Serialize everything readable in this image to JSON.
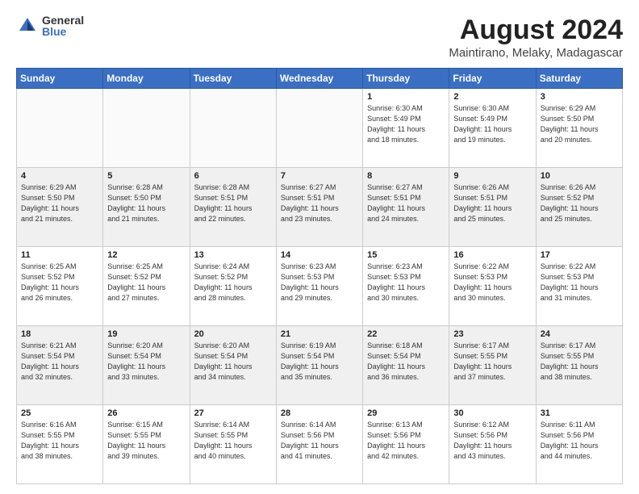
{
  "header": {
    "logo_general": "General",
    "logo_blue": "Blue",
    "title": "August 2024",
    "subtitle": "Maintirano, Melaky, Madagascar"
  },
  "days_of_week": [
    "Sunday",
    "Monday",
    "Tuesday",
    "Wednesday",
    "Thursday",
    "Friday",
    "Saturday"
  ],
  "weeks": [
    [
      {
        "day": "",
        "info": ""
      },
      {
        "day": "",
        "info": ""
      },
      {
        "day": "",
        "info": ""
      },
      {
        "day": "",
        "info": ""
      },
      {
        "day": "1",
        "info": "Sunrise: 6:30 AM\nSunset: 5:49 PM\nDaylight: 11 hours\nand 18 minutes."
      },
      {
        "day": "2",
        "info": "Sunrise: 6:30 AM\nSunset: 5:49 PM\nDaylight: 11 hours\nand 19 minutes."
      },
      {
        "day": "3",
        "info": "Sunrise: 6:29 AM\nSunset: 5:50 PM\nDaylight: 11 hours\nand 20 minutes."
      }
    ],
    [
      {
        "day": "4",
        "info": "Sunrise: 6:29 AM\nSunset: 5:50 PM\nDaylight: 11 hours\nand 21 minutes."
      },
      {
        "day": "5",
        "info": "Sunrise: 6:28 AM\nSunset: 5:50 PM\nDaylight: 11 hours\nand 21 minutes."
      },
      {
        "day": "6",
        "info": "Sunrise: 6:28 AM\nSunset: 5:51 PM\nDaylight: 11 hours\nand 22 minutes."
      },
      {
        "day": "7",
        "info": "Sunrise: 6:27 AM\nSunset: 5:51 PM\nDaylight: 11 hours\nand 23 minutes."
      },
      {
        "day": "8",
        "info": "Sunrise: 6:27 AM\nSunset: 5:51 PM\nDaylight: 11 hours\nand 24 minutes."
      },
      {
        "day": "9",
        "info": "Sunrise: 6:26 AM\nSunset: 5:51 PM\nDaylight: 11 hours\nand 25 minutes."
      },
      {
        "day": "10",
        "info": "Sunrise: 6:26 AM\nSunset: 5:52 PM\nDaylight: 11 hours\nand 25 minutes."
      }
    ],
    [
      {
        "day": "11",
        "info": "Sunrise: 6:25 AM\nSunset: 5:52 PM\nDaylight: 11 hours\nand 26 minutes."
      },
      {
        "day": "12",
        "info": "Sunrise: 6:25 AM\nSunset: 5:52 PM\nDaylight: 11 hours\nand 27 minutes."
      },
      {
        "day": "13",
        "info": "Sunrise: 6:24 AM\nSunset: 5:52 PM\nDaylight: 11 hours\nand 28 minutes."
      },
      {
        "day": "14",
        "info": "Sunrise: 6:23 AM\nSunset: 5:53 PM\nDaylight: 11 hours\nand 29 minutes."
      },
      {
        "day": "15",
        "info": "Sunrise: 6:23 AM\nSunset: 5:53 PM\nDaylight: 11 hours\nand 30 minutes."
      },
      {
        "day": "16",
        "info": "Sunrise: 6:22 AM\nSunset: 5:53 PM\nDaylight: 11 hours\nand 30 minutes."
      },
      {
        "day": "17",
        "info": "Sunrise: 6:22 AM\nSunset: 5:53 PM\nDaylight: 11 hours\nand 31 minutes."
      }
    ],
    [
      {
        "day": "18",
        "info": "Sunrise: 6:21 AM\nSunset: 5:54 PM\nDaylight: 11 hours\nand 32 minutes."
      },
      {
        "day": "19",
        "info": "Sunrise: 6:20 AM\nSunset: 5:54 PM\nDaylight: 11 hours\nand 33 minutes."
      },
      {
        "day": "20",
        "info": "Sunrise: 6:20 AM\nSunset: 5:54 PM\nDaylight: 11 hours\nand 34 minutes."
      },
      {
        "day": "21",
        "info": "Sunrise: 6:19 AM\nSunset: 5:54 PM\nDaylight: 11 hours\nand 35 minutes."
      },
      {
        "day": "22",
        "info": "Sunrise: 6:18 AM\nSunset: 5:54 PM\nDaylight: 11 hours\nand 36 minutes."
      },
      {
        "day": "23",
        "info": "Sunrise: 6:17 AM\nSunset: 5:55 PM\nDaylight: 11 hours\nand 37 minutes."
      },
      {
        "day": "24",
        "info": "Sunrise: 6:17 AM\nSunset: 5:55 PM\nDaylight: 11 hours\nand 38 minutes."
      }
    ],
    [
      {
        "day": "25",
        "info": "Sunrise: 6:16 AM\nSunset: 5:55 PM\nDaylight: 11 hours\nand 38 minutes."
      },
      {
        "day": "26",
        "info": "Sunrise: 6:15 AM\nSunset: 5:55 PM\nDaylight: 11 hours\nand 39 minutes."
      },
      {
        "day": "27",
        "info": "Sunrise: 6:14 AM\nSunset: 5:55 PM\nDaylight: 11 hours\nand 40 minutes."
      },
      {
        "day": "28",
        "info": "Sunrise: 6:14 AM\nSunset: 5:56 PM\nDaylight: 11 hours\nand 41 minutes."
      },
      {
        "day": "29",
        "info": "Sunrise: 6:13 AM\nSunset: 5:56 PM\nDaylight: 11 hours\nand 42 minutes."
      },
      {
        "day": "30",
        "info": "Sunrise: 6:12 AM\nSunset: 5:56 PM\nDaylight: 11 hours\nand 43 minutes."
      },
      {
        "day": "31",
        "info": "Sunrise: 6:11 AM\nSunset: 5:56 PM\nDaylight: 11 hours\nand 44 minutes."
      }
    ]
  ]
}
